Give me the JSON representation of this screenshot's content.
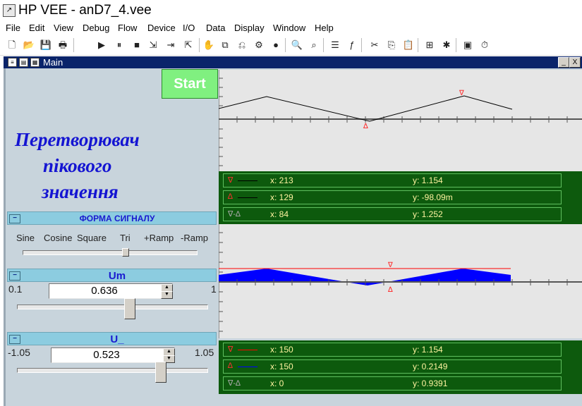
{
  "app": {
    "title": "HP VEE - anD7_4.vee"
  },
  "menu": [
    "File",
    "Edit",
    "View",
    "Debug",
    "Flow",
    "Device",
    "I/O",
    "Data",
    "Display",
    "Window",
    "Help"
  ],
  "window": {
    "title": "Main",
    "minimize": "_",
    "close": "X"
  },
  "start_button": "Start",
  "heading": {
    "line1": "Перетворювач",
    "line2": "пікового",
    "line3": "значення"
  },
  "waveform": {
    "title": "ФОРМА СИГНАЛУ",
    "options": [
      "Sine",
      "Cosine",
      "Square",
      "Tri",
      "+Ramp",
      "-Ramp"
    ],
    "selected": "Tri"
  },
  "um": {
    "title": "Um",
    "min": "0.1",
    "max": "1",
    "value": "0.636",
    "fraction": 0.596
  },
  "u_offset": {
    "title": "U_",
    "min": "-1.05",
    "max": "1.05",
    "value": "0.523",
    "fraction": 0.749
  },
  "graph1": {
    "markers": [
      {
        "symbol": "∇",
        "x": "x: 213",
        "y": "y: 1.154",
        "color": "#ff3030",
        "line": "#000000"
      },
      {
        "symbol": "∆",
        "x": "x: 129",
        "y": "y: -98.09m",
        "color": "#ff3030",
        "line": "#000000"
      },
      {
        "symbol": "∇-∆",
        "x": "x: 84",
        "y": "y: 1.252",
        "color": "#aaaaaa",
        "line": ""
      }
    ]
  },
  "graph2": {
    "markers": [
      {
        "symbol": "∇",
        "x": "x: 150",
        "y": "y: 1.154",
        "color": "#ff3030",
        "line": "#ff0000"
      },
      {
        "symbol": "∆",
        "x": "x: 150",
        "y": "y: 0.2149",
        "color": "#ff3030",
        "line": "#0000ff"
      },
      {
        "symbol": "∇-∆",
        "x": "x: 0",
        "y": "y: 0.9391",
        "color": "#aaaaaa",
        "line": ""
      }
    ]
  },
  "colors": {
    "window_bg": "#c8d4dc",
    "panel_head": "#8ccce0",
    "start_bg": "#80f080",
    "heading": "#1414d2",
    "marker_panel": "#0d5a0d",
    "fill": "#0000ff"
  },
  "toolbar_icons": [
    "new-icon",
    "open-icon",
    "save-icon",
    "print-icon",
    "run-icon",
    "pause-icon",
    "stop-icon",
    "step-into-icon",
    "step-over-icon",
    "step-out-icon",
    "hand-icon",
    "copy-object-icon",
    "connect-icon",
    "debug-icon",
    "globe-icon",
    "find-icon",
    "find-next-icon",
    "properties-icon",
    "function-icon",
    "cut-icon",
    "copy-icon",
    "paste-icon",
    "align-icon",
    "bug-icon",
    "panel-icon",
    "timer-icon"
  ]
}
